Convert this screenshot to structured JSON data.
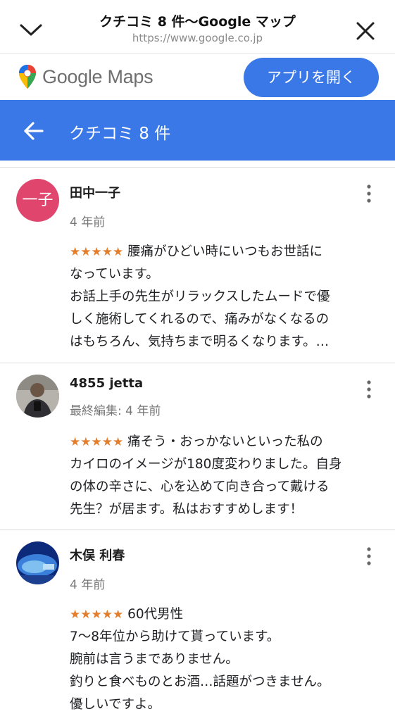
{
  "sheet": {
    "title": "クチコミ 8 件〜Google マップ",
    "url": "https://www.google.co.jp"
  },
  "brand": {
    "name": "Google Maps",
    "open_app_label": "アプリを開く"
  },
  "header": {
    "title": "クチコミ 8 件"
  },
  "reviews": [
    {
      "name": "田中一子",
      "avatar_text": "一子",
      "avatar_color": "#e0456e",
      "time": "4 年前",
      "stars": "★★★★★",
      "lines": [
        " 腰痛がひどい時にいつもお世話に",
        "なっています。",
        "お話上手の先生がリラックスしたムードで優",
        "しく施術してくれるので、痛みがなくなるの",
        "はもちろん、気持ちまで明るくなります。…"
      ]
    },
    {
      "name": "4855 jetta",
      "time": "最終編集: 4 年前",
      "stars": "★★★★★",
      "lines": [
        " 痛そう・おっかないといった私の",
        "カイロのイメージが180度変わりました。自身",
        "の体の辛さに、心を込めて向き合って戴ける",
        "先生？が居ます。私はおすすめします！"
      ]
    },
    {
      "name": "木俣 利春",
      "time": "4 年前",
      "stars": "★★★★★",
      "lines": [
        " 60代男性",
        "7〜8年位から助けて貰っています。",
        "腕前は言うまでありません。",
        "釣りと食べものとお酒…話題がつきません。",
        "優しいですよ。"
      ]
    }
  ],
  "colors": {
    "accent_blue": "#3b78e7",
    "star_orange": "#e37e2d"
  },
  "icons": {
    "collapse": "chevron-down-icon",
    "close": "close-icon",
    "back": "arrow-left-icon",
    "more": "more-vert-icon",
    "pin": "maps-pin-icon"
  }
}
